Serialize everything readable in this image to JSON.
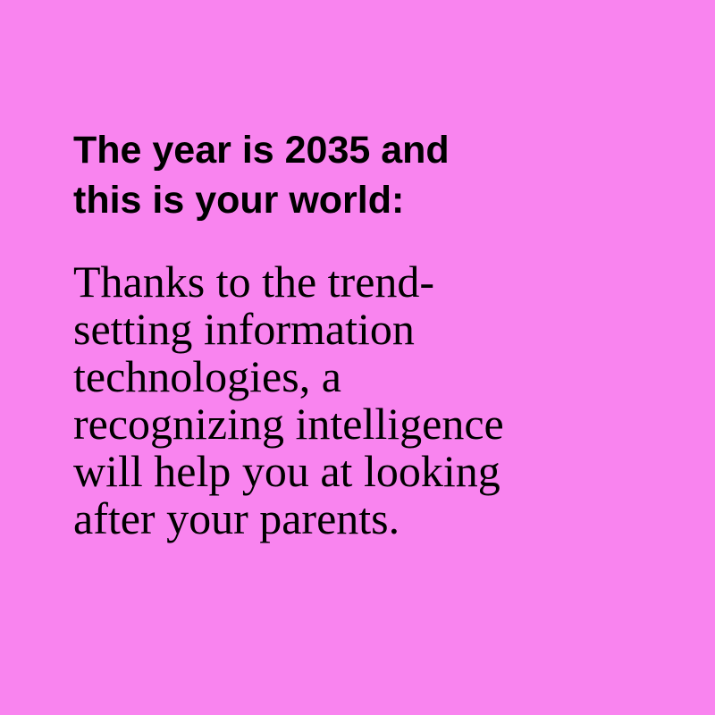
{
  "colors": {
    "background": "#f984ef",
    "text": "#000000"
  },
  "heading": {
    "lines": [
      "The year is 2035 and",
      "this is your world:"
    ]
  },
  "body": {
    "lines": [
      "Thanks to the trend-",
      "setting information",
      "technologies, a",
      "recognizing intelligence",
      "will help you at looking",
      "after your parents."
    ]
  }
}
